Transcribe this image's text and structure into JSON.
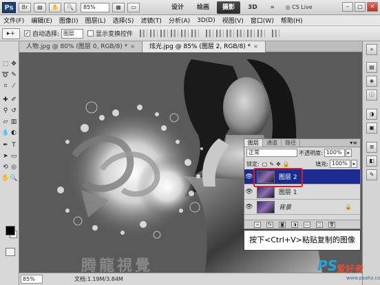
{
  "appbar": {
    "logo": "Ps",
    "zoom": "85%",
    "workspaces": [
      "设计",
      "绘画",
      "摄影",
      "3D"
    ],
    "cslive": "CS Live"
  },
  "menu": [
    "文件(F)",
    "编辑(E)",
    "图像(I)",
    "图层(L)",
    "选择(S)",
    "滤镜(T)",
    "分析(A)",
    "3D(D)",
    "视图(V)",
    "窗口(W)",
    "帮助(H)"
  ],
  "options": {
    "auto_select_label": "自动选择:",
    "auto_select_value": "图层",
    "show_transform_label": "显示变换控件"
  },
  "tabs": [
    {
      "label": "人物.jpg @ 80% (图层 0, RGB/8) *"
    },
    {
      "label": "炫光.jpg @ 85% (图层 2, RGB/8) *"
    }
  ],
  "status": {
    "zoom": "85%",
    "doc": "文档:1.19M/3.84M"
  },
  "layers_panel": {
    "tabs": [
      "图层",
      "通道",
      "路径"
    ],
    "blend_mode": "正常",
    "opacity_label": "不透明度:",
    "opacity": "100%",
    "lock_label": "锁定:",
    "fill_label": "填充:",
    "fill": "100%",
    "layers": [
      {
        "name": "图层 2",
        "selected": true
      },
      {
        "name": "图层 1",
        "selected": false
      },
      {
        "name": "背景",
        "selected": false
      }
    ]
  },
  "callout": "按下<Ctrl+V>粘贴复制的图像",
  "watermark": {
    "left": "腾龍視覺",
    "right_ps": "PS",
    "right_cn": "爱好者",
    "right_url": "www.psahz.com"
  },
  "colors": {
    "selection_blue": "#1b2b8f",
    "highlight_red": "#d82020"
  }
}
